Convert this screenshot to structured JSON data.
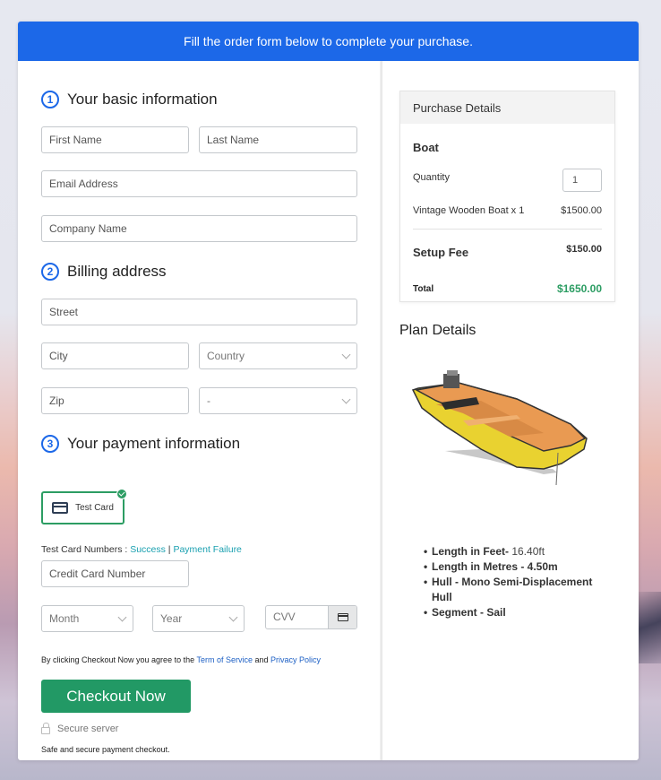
{
  "banner": {
    "text": "Fill the order form below to complete your purchase."
  },
  "sections": {
    "basic": {
      "num": "1",
      "title": "Your basic information"
    },
    "billing": {
      "num": "2",
      "title": "Billing address"
    },
    "payment": {
      "num": "3",
      "title": "Your payment information"
    }
  },
  "fields": {
    "first_name": "First Name",
    "last_name": "Last Name",
    "email": "Email Address",
    "company": "Company Name",
    "street": "Street",
    "city": "City",
    "country": "Country",
    "zip": "Zip",
    "state": "-",
    "card_number": "Credit Card Number",
    "month": "Month",
    "year": "Year",
    "cvv": "CVV"
  },
  "payment": {
    "method_label": "Test Card",
    "test_numbers_label": "Test Card Numbers : ",
    "success_link": "Success",
    "separator": " | ",
    "failure_link": "Payment Failure"
  },
  "terms": {
    "prefix": "By clicking Checkout Now you agree to the ",
    "tos": "Term of Service",
    "and": " and ",
    "privacy": "Privacy Policy"
  },
  "checkout_button": "Checkout Now",
  "secure_label": "Secure server",
  "safe_label": "Safe and secure payment checkout.",
  "purchase": {
    "title": "Purchase Details",
    "product": "Boat",
    "quantity_label": "Quantity",
    "quantity": "1",
    "item_label": "Vintage Wooden Boat x 1",
    "item_price": "$1500.00",
    "setup_label": "Setup Fee",
    "setup_price": "$150.00",
    "total_label": "Total",
    "total_price": "$1650.00",
    "total_color": "#2c9d63"
  },
  "plan": {
    "title": "Plan Details",
    "image": "boat-image",
    "specs": [
      {
        "label": "Length in Feet-",
        "value": " 16.40ft"
      },
      {
        "label": "Length in Metres - 4.50m",
        "value": ""
      },
      {
        "label": "Hull - Mono Semi-Displacement Hull",
        "value": ""
      },
      {
        "label": "Segment - Sail",
        "value": ""
      }
    ]
  },
  "colors": {
    "brand_blue": "#1c68e8",
    "checkout_green": "#229965",
    "link_teal": "#1aa0b0"
  }
}
